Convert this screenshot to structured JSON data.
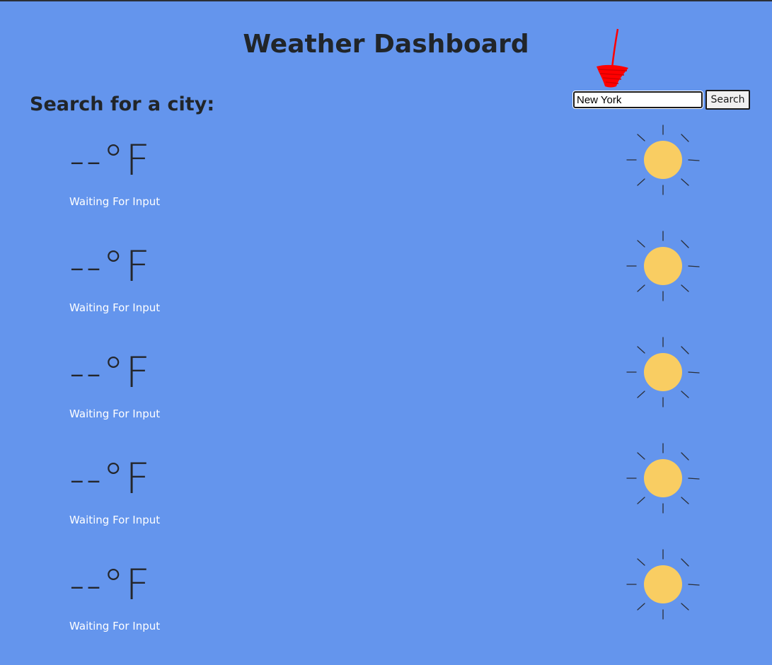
{
  "header": {
    "title": "Weather Dashboard"
  },
  "search": {
    "label": "Search for a city:",
    "value": "New York",
    "button_label": "Search"
  },
  "forecast": [
    {
      "temp": "--°F",
      "status": "Waiting For Input",
      "icon": "sun-icon"
    },
    {
      "temp": "--°F",
      "status": "Waiting For Input",
      "icon": "sun-icon"
    },
    {
      "temp": "--°F",
      "status": "Waiting For Input",
      "icon": "sun-icon"
    },
    {
      "temp": "--°F",
      "status": "Waiting For Input",
      "icon": "sun-icon"
    },
    {
      "temp": "--°F",
      "status": "Waiting For Input",
      "icon": "sun-icon"
    }
  ],
  "colors": {
    "background": "#6495ED",
    "sun": "#F9CD62",
    "annotation": "#FF0000"
  }
}
